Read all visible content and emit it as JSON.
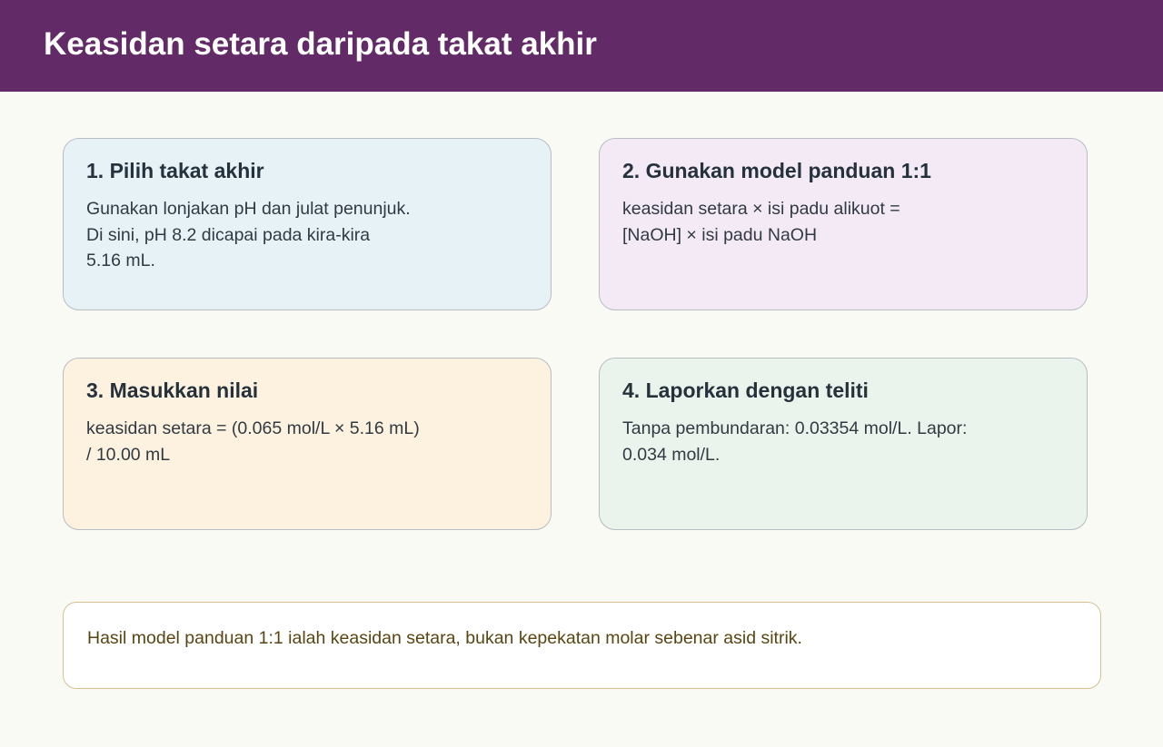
{
  "header": {
    "title": "Keasidan setara daripada takat akhir"
  },
  "steps": [
    {
      "title": "1. Pilih takat akhir",
      "body": "Gunakan lonjakan pH dan julat penunjuk.\nDi sini, pH 8.2 dicapai pada kira-kira\n5.16 mL."
    },
    {
      "title": "2. Gunakan model panduan 1:1",
      "body": "keasidan setara × isi padu alikuot =\n[NaOH] × isi padu NaOH"
    },
    {
      "title": "3. Masukkan nilai",
      "body": "keasidan setara = (0.065 mol/L × 5.16 mL)\n/ 10.00 mL"
    },
    {
      "title": "4. Laporkan dengan teliti",
      "body": "Tanpa pembundaran: 0.03354 mol/L. Lapor:\n0.034 mol/L."
    }
  ],
  "note": {
    "text": "Hasil model panduan 1:1 ialah keasidan setara, bukan kepekatan molar sebenar asid sitrik."
  },
  "colors": {
    "header": "#632a68",
    "step_1_bg": "#e7f2f7",
    "step_2_bg": "#f3eaf6",
    "step_3_bg": "#fdf2e0",
    "step_4_bg": "#eaf4ec",
    "note_border": "#d3c192",
    "note_text": "#5a4512"
  }
}
